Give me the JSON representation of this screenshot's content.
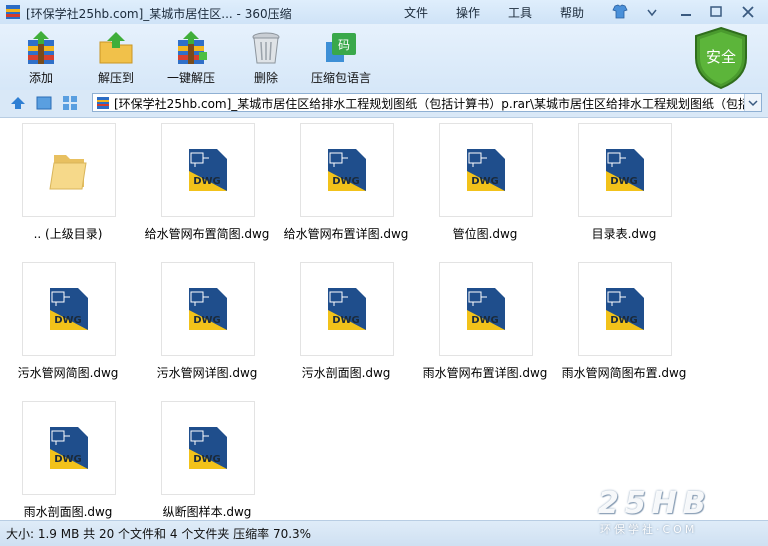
{
  "window": {
    "title": "[环保学社25hb.com]_某城市居住区... - 360压缩"
  },
  "menu": [
    {
      "label": "文件"
    },
    {
      "label": "操作"
    },
    {
      "label": "工具"
    },
    {
      "label": "帮助"
    }
  ],
  "toolbar": {
    "tools": [
      {
        "label": "添加",
        "icon": "add-archive-icon"
      },
      {
        "label": "解压到",
        "icon": "extract-to-icon"
      },
      {
        "label": "一键解压",
        "icon": "one-click-extract-icon"
      },
      {
        "label": "删除",
        "icon": "trash-icon"
      },
      {
        "label": "压缩包语言",
        "icon": "archive-language-icon"
      }
    ],
    "security_badge": "安全"
  },
  "address": {
    "path": "[环保学社25hb.com]_某城市居住区给排水工程规划图纸（包括计算书）p.rar\\某城市居住区给排水工程规划图纸（包括"
  },
  "files": [
    {
      "name": ".. (上级目录)",
      "type": "folder"
    },
    {
      "name": "给水管网布置简图.dwg",
      "type": "dwg",
      "badge": "DWG"
    },
    {
      "name": "给水管网布置详图.dwg",
      "type": "dwg",
      "badge": "DWG"
    },
    {
      "name": "管位图.dwg",
      "type": "dwg",
      "badge": "DWG"
    },
    {
      "name": "目录表.dwg",
      "type": "dwg",
      "badge": "DWG"
    },
    {
      "name": "污水管网简图.dwg",
      "type": "dwg",
      "badge": "DWG"
    },
    {
      "name": "污水管网详图.dwg",
      "type": "dwg",
      "badge": "DWG"
    },
    {
      "name": "污水剖面图.dwg",
      "type": "dwg",
      "badge": "DWG"
    },
    {
      "name": "雨水管网布置详图.dwg",
      "type": "dwg",
      "badge": "DWG"
    },
    {
      "name": "雨水管网简图布置.dwg",
      "type": "dwg",
      "badge": "DWG"
    },
    {
      "name": "雨水剖面图.dwg",
      "type": "dwg",
      "badge": "DWG"
    },
    {
      "name": "纵断图样本.dwg",
      "type": "dwg",
      "badge": "DWG"
    }
  ],
  "status": {
    "text": "大小: 1.9 MB 共 20 个文件和 4 个文件夹 压缩率 70.3%"
  },
  "watermark": {
    "big": "25HB",
    "small": "环保学社·COM"
  },
  "colors": {
    "accent": "#2f7fd3",
    "shield": "#4a9a2e",
    "dwg_yellow": "#f2c21a",
    "dwg_blue": "#1f4e8c"
  }
}
